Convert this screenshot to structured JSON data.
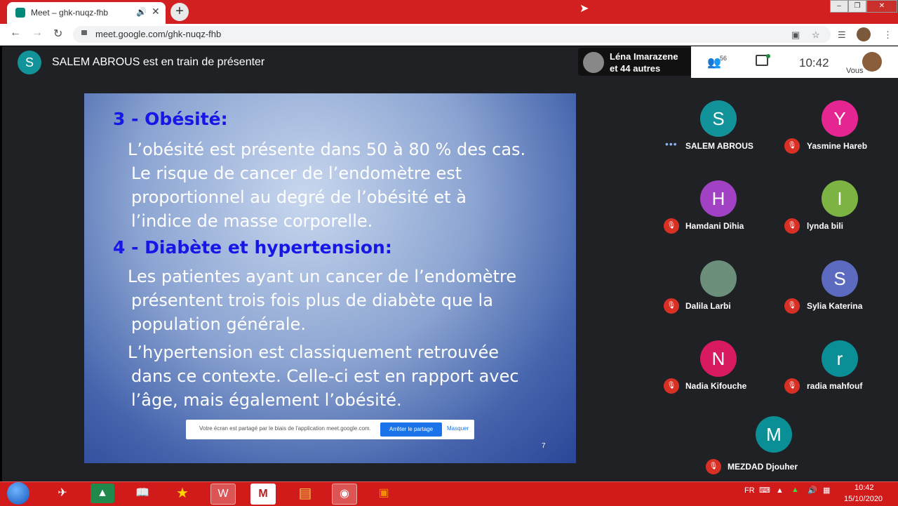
{
  "browser": {
    "tab_title": "Meet – ghk-nuqz-fhb",
    "url": "meet.google.com/ghk-nuqz-fhb"
  },
  "meet": {
    "presenter_initial": "S",
    "presenting_text": "SALEM ABROUS est en train de présenter",
    "info_name": "Léna Imarazene",
    "info_others": "et 44 autres",
    "people_count": "56",
    "time": "10:42",
    "self_label": "Vous"
  },
  "slide": {
    "heading1": "3 - Obésité:",
    "p1_lines": [
      "L’obésité est présente dans 50 à 80 % des cas.",
      "Le risque de cancer de l’endomètre est",
      "proportionnel au degré de l’obésité et à",
      "l’indice de masse corporelle."
    ],
    "heading2": "4 - Diabète et hypertension:",
    "p2_lines": [
      "Les patientes ayant un cancer de l’endomètre",
      "présentent trois fois plus de diabète que la",
      "population générale."
    ],
    "p3_lines": [
      "L’hypertension est classiquement retrouvée",
      "dans ce contexte. Celle-ci est en rapport avec",
      "l’âge, mais également l’obésité."
    ],
    "page_number": "7",
    "share_banner_text": "Votre écran est partagé par le biais de l'application meet.google.com.",
    "share_stop_label": "Arrêter le partage",
    "share_hide_label": "Masquer"
  },
  "participants": [
    {
      "initial": "S",
      "name": "SALEM ABROUS",
      "color": "#12939a",
      "muted": false
    },
    {
      "initial": "Y",
      "name": "Yasmine Hareb",
      "color": "#e52592",
      "muted": true
    },
    {
      "initial": "H",
      "name": "Hamdani Dihia",
      "color": "#a142c4",
      "muted": true
    },
    {
      "initial": "I",
      "name": "lynda bili",
      "color": "#7cb342",
      "muted": true
    },
    {
      "initial": "",
      "name": "Dalila Larbi",
      "color": "#6b8f7a",
      "muted": true
    },
    {
      "initial": "S",
      "name": "Sylia Katerina",
      "color": "#5c6bc0",
      "muted": true
    },
    {
      "initial": "N",
      "name": "Nadia Kifouche",
      "color": "#d81b60",
      "muted": true
    },
    {
      "initial": "r",
      "name": "radia mahfouf",
      "color": "#0b8f96",
      "muted": true
    },
    {
      "initial": "M",
      "name": "MEZDAD Djouher",
      "color": "#0b8f96",
      "muted": true
    }
  ],
  "taskbar": {
    "lang": "FR",
    "time": "10:42",
    "date": "15/10/2020"
  }
}
